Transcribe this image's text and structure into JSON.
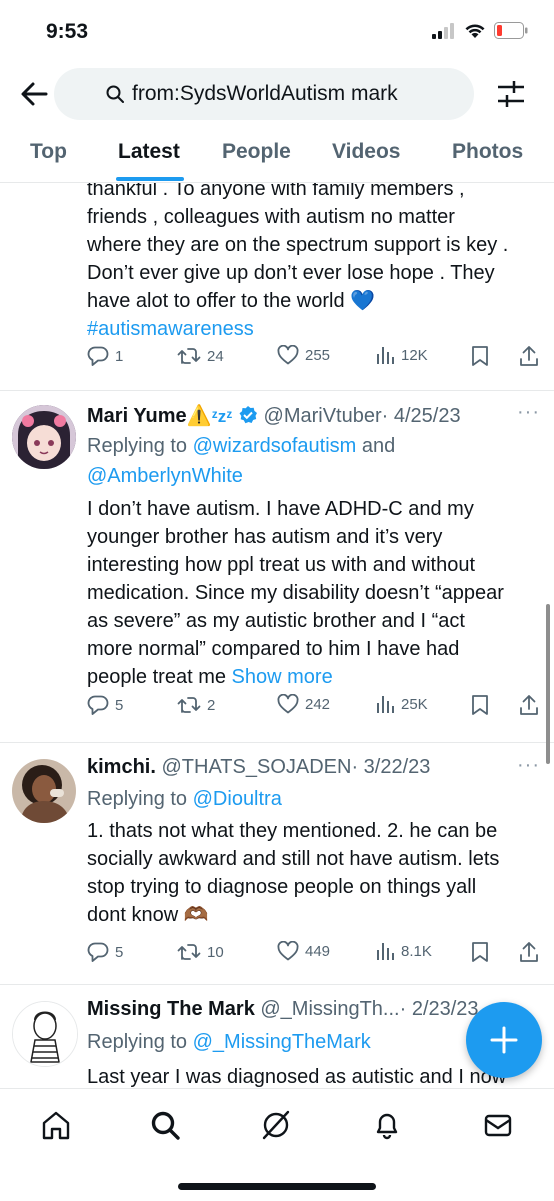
{
  "status_bar": {
    "time": "9:53"
  },
  "search": {
    "query": "from:SydsWorldAutism mark"
  },
  "tabs": [
    {
      "label": "Top"
    },
    {
      "label": "Latest"
    },
    {
      "label": "People"
    },
    {
      "label": "Videos"
    },
    {
      "label": "Photos"
    }
  ],
  "tweets": [
    {
      "body_lines": [
        "thankful . To anyone with family members ,",
        "friends , colleagues with autism  no matter",
        "where they are on the spectrum support is key .",
        "Don’t ever give up don’t ever lose hope . They",
        "have alot to offer to the world"
      ],
      "heart_emoji": "💙",
      "hashtag": "#autismawareness",
      "replies": "1",
      "retweets": "24",
      "likes": "255",
      "views": "12K"
    },
    {
      "name": "Mari Yume",
      "name_emoji": "⚠️",
      "name_zzz": "ᶻzᶻ",
      "handle": "@MariVtuber",
      "date": "· 4/25/23",
      "replying_prefix": "Replying to",
      "replying_to": "@wizardsofautism",
      "replying_and": "and",
      "replying_to_2": "@AmberlynWhite",
      "body_lines": [
        "I don’t have autism. I have ADHD-C and my",
        "younger brother has autism and it’s very",
        "interesting how ppl treat us with and without",
        "medication. Since my disability doesn’t “appear",
        "as severe” as my autistic brother and I “act",
        "more normal” compared to him I have had",
        "people treat me"
      ],
      "show_more": "Show more",
      "replies": "5",
      "retweets": "2",
      "likes": "242",
      "views": "25K"
    },
    {
      "name": "kimchi.",
      "handle": "@THATS_SOJADEN",
      "date": "· 3/22/23",
      "replying_prefix": "Replying to",
      "replying_to": "@Dioultra",
      "body_lines": [
        "1. thats not what they mentioned. 2. he can be",
        "socially awkward and still not have autism. lets",
        "stop trying to diagnose people on things yall",
        "dont know"
      ],
      "body_emoji": "🫶🏾",
      "replies": "5",
      "retweets": "10",
      "likes": "449",
      "views": "8.1K"
    },
    {
      "name": "Missing The Mark",
      "handle": "@_MissingTh...",
      "date": "· 2/23/23",
      "replying_prefix": "Replying to",
      "replying_to": "@_MissingTheMark",
      "body_lines": [
        "Last year I was diagnosed as autistic and I now"
      ]
    }
  ],
  "colors": {
    "accent": "#1d9bf0",
    "text": "#0f1419",
    "muted": "#536471"
  }
}
